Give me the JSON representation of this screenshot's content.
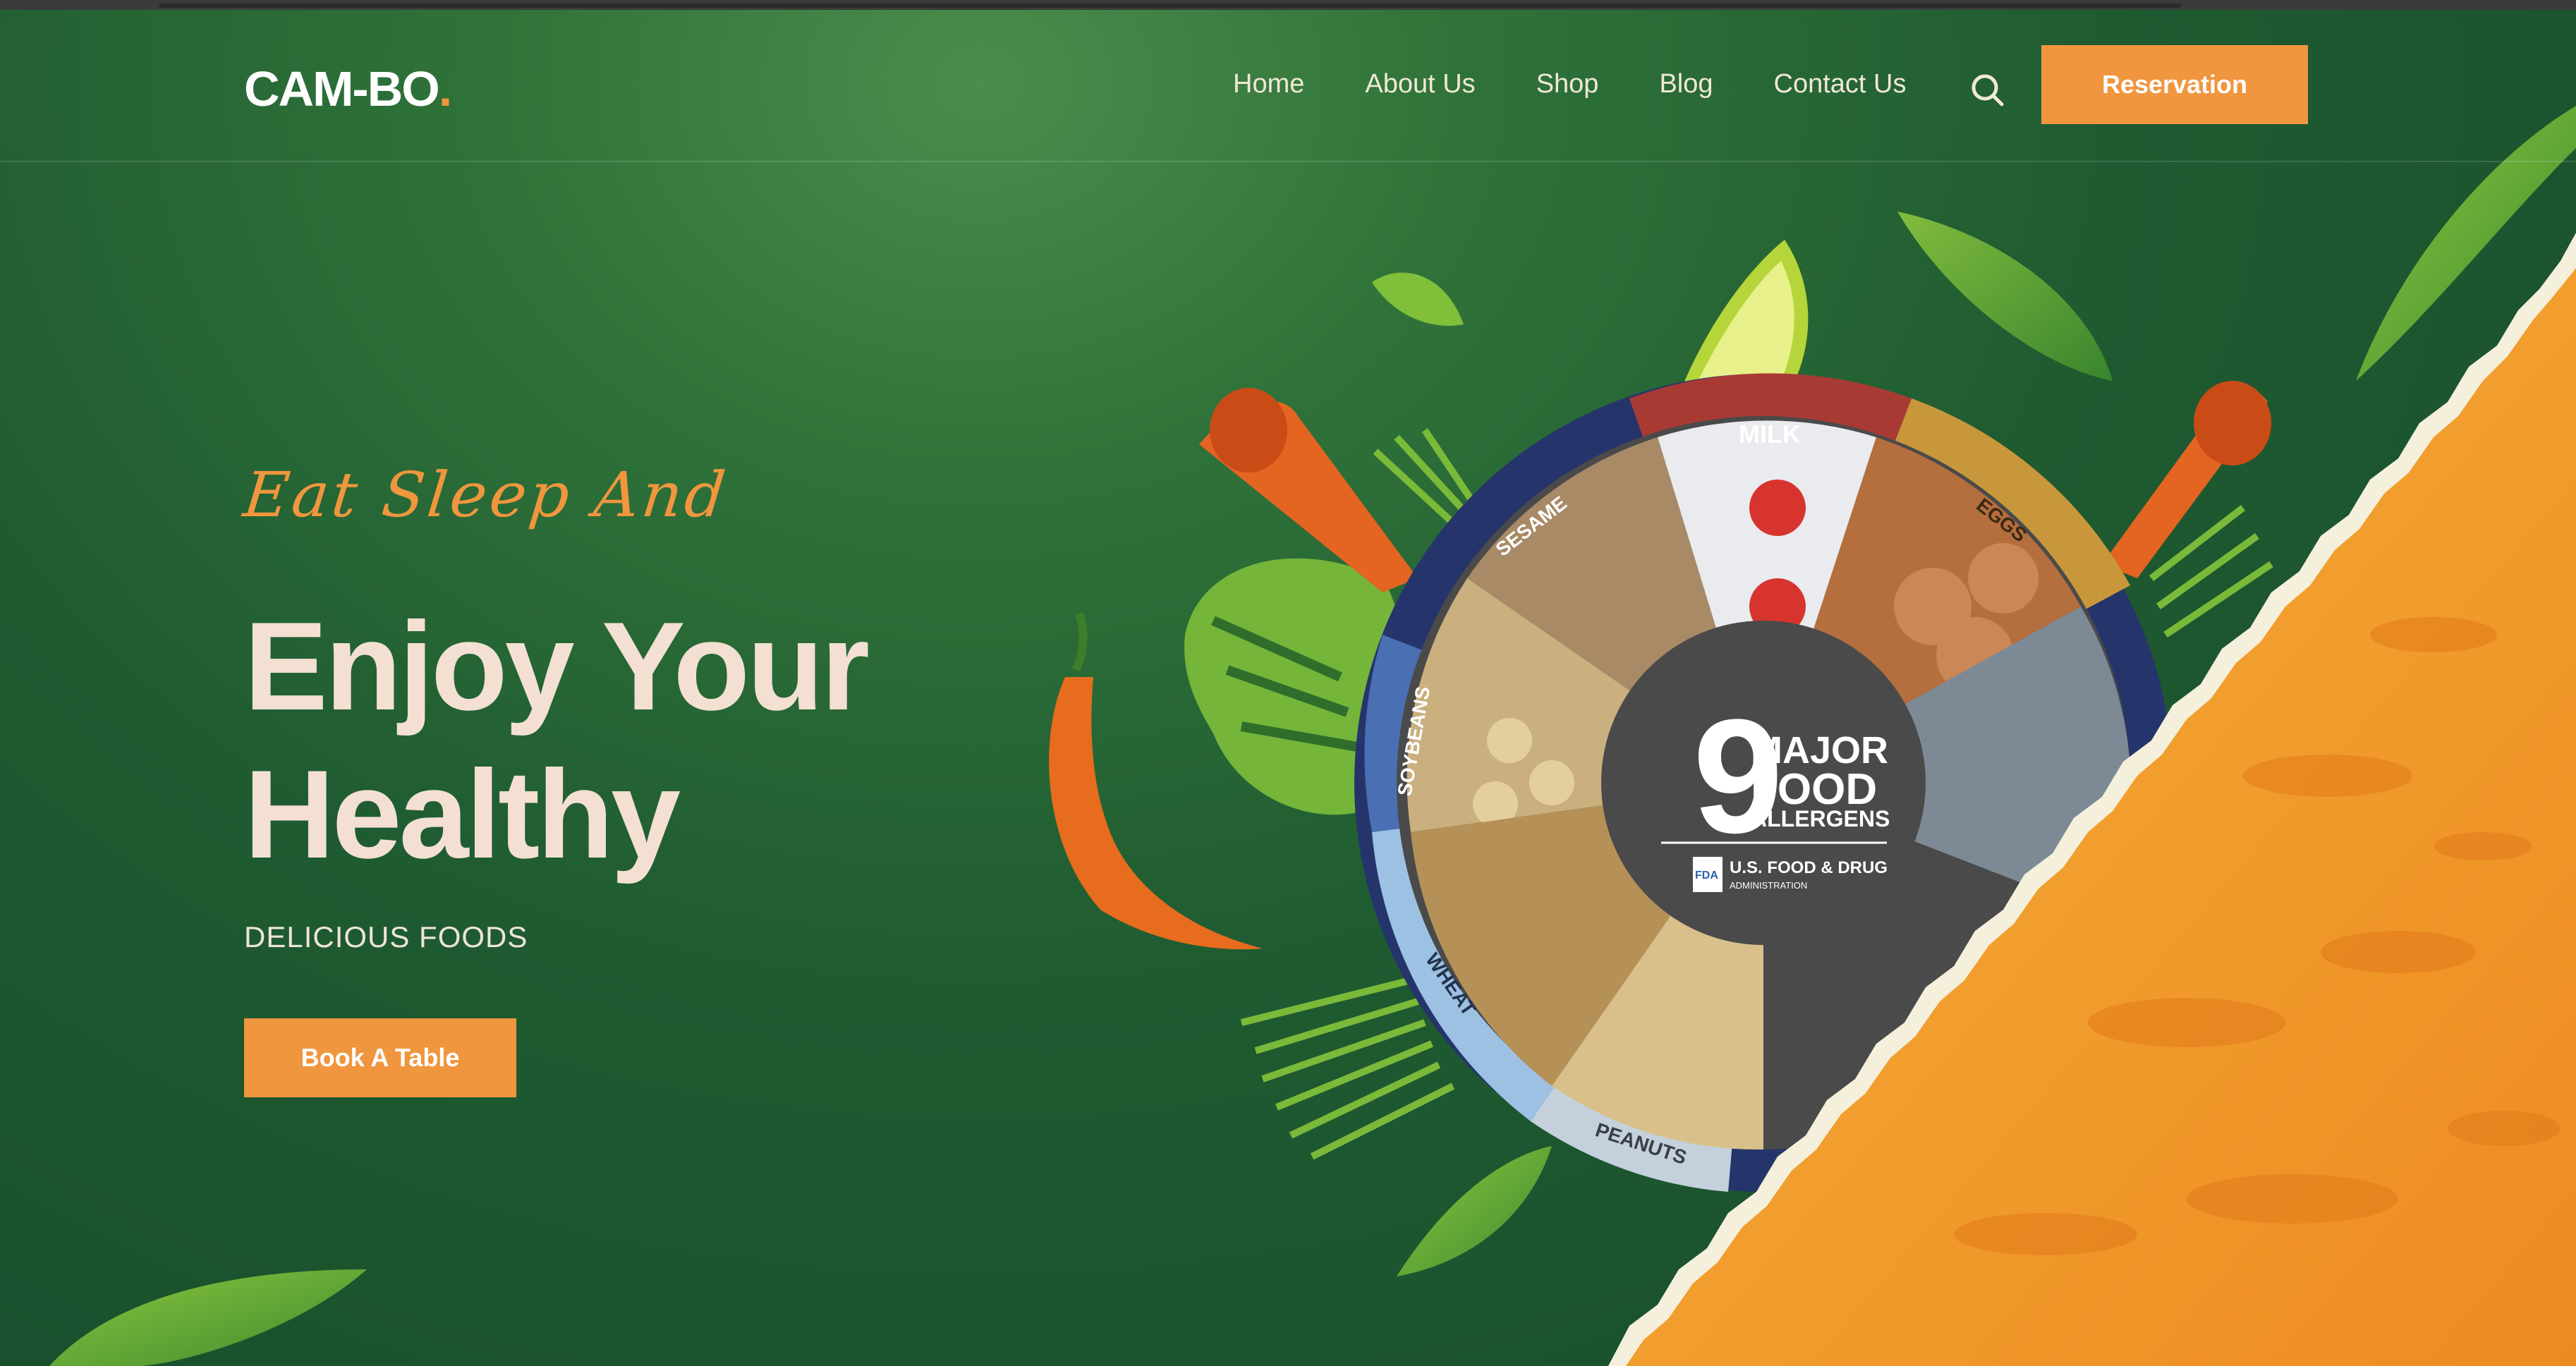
{
  "brand": {
    "name": "CAM-BO",
    "dot": "."
  },
  "nav": {
    "items": [
      "Home",
      "About Us",
      "Shop",
      "Blog",
      "Contact Us"
    ],
    "search_icon": "search-icon",
    "reservation_label": "Reservation"
  },
  "hero": {
    "eyebrow": "Eat Sleep And",
    "headline_line1": "Enjoy Your",
    "headline_line2": "Healthy",
    "subheadline": "DELICIOUS FOODS",
    "cta_label": "Book A Table"
  },
  "allergen_wheel": {
    "number": "9",
    "title_line1": "MAJOR",
    "title_line2": "FOOD",
    "title_line3": "ALLERGENS",
    "agency_mark": "FDA",
    "agency_line1": "U.S. FOOD & DRUG",
    "agency_line2": "ADMINISTRATION",
    "segments": [
      "MILK",
      "EGGS",
      "SESAME",
      "SOYBEANS",
      "WHEAT",
      "PEANUTS"
    ]
  },
  "colors": {
    "accent": "#f0963e",
    "background_green": "#1f5b31",
    "headline": "#f3e0d3",
    "splash_orange": "#f2a32f"
  }
}
